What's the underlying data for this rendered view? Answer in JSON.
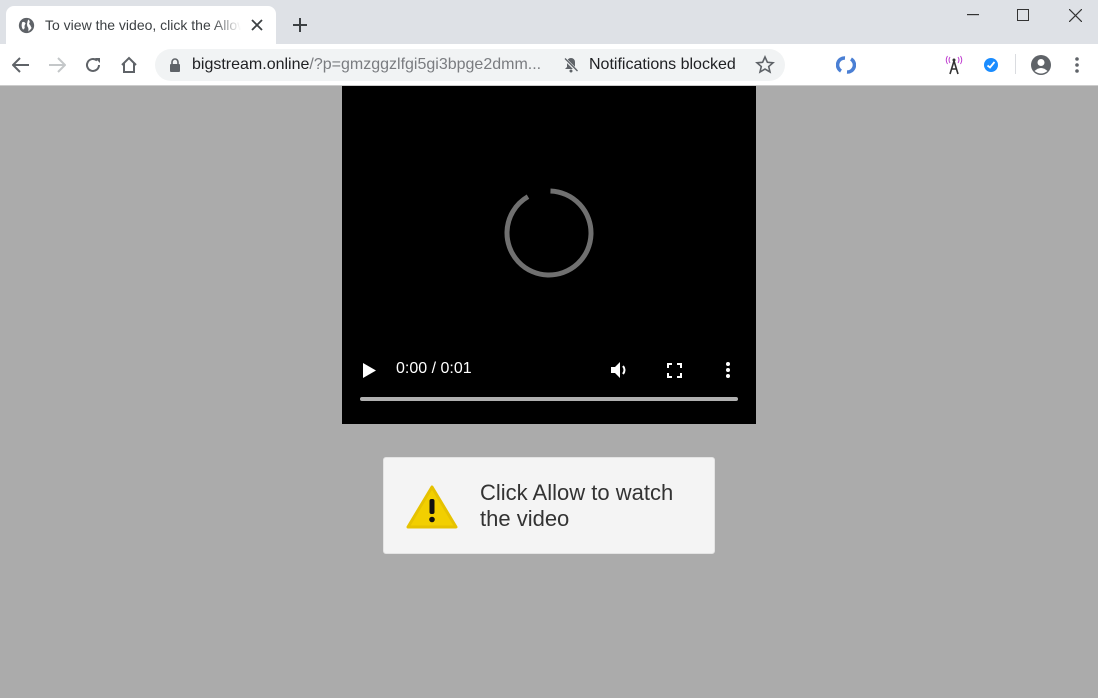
{
  "browser": {
    "tab": {
      "title": "To view the video, click the Allow button",
      "favicon": "globe-icon"
    },
    "new_tab_label": "+",
    "window_controls": [
      "minimize",
      "maximize",
      "close"
    ],
    "address_bar": {
      "domain": "bigstream.online",
      "path": "/?p=gmzggzlfgi5gi3bpge2dmm...",
      "secure_icon": "lock-icon"
    },
    "notifications_status": "Notifications blocked",
    "extensions": [
      "sync-extension-icon",
      "antenna-extension-icon",
      "check-extension-icon"
    ]
  },
  "video_player": {
    "state": "loading",
    "current_time": "0:00",
    "duration": "0:01",
    "time_display": "0:00 / 0:01",
    "progress_fraction": 0
  },
  "alert": {
    "icon": "warning-icon",
    "message": "Click Allow to watch the video"
  },
  "colors": {
    "page_background": "#ababab",
    "titlebar": "#dee1e6",
    "warning_yellow": "#f2cf00",
    "spinner": "#707070"
  }
}
